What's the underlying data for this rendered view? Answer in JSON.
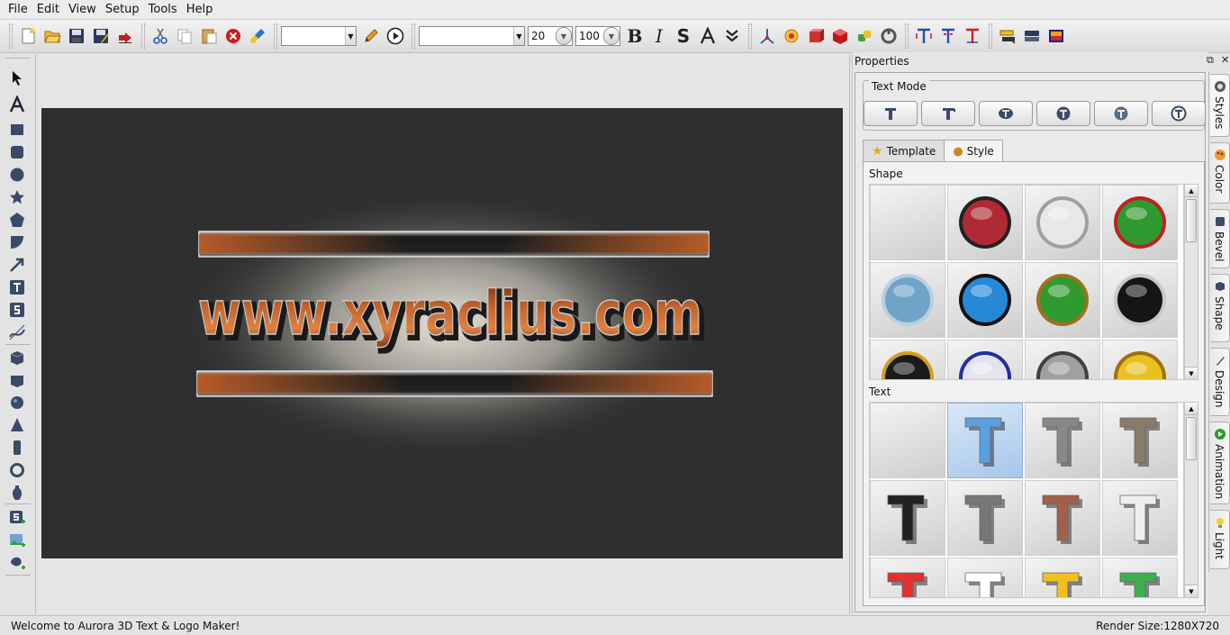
{
  "menu": [
    "File",
    "Edit",
    "View",
    "Setup",
    "Tools",
    "Help"
  ],
  "toolbar": {
    "font_size": "20",
    "zoom": "100",
    "bold_label": "B",
    "italic_label": "I",
    "strike_label": "S"
  },
  "canvas": {
    "logo_text": "www.xyraclius.com",
    "background_color": "#2f2f2f",
    "glow_color": "#d8d6c8",
    "text_color": "#b85a28"
  },
  "properties": {
    "title": "Properties",
    "text_mode_label": "Text Mode",
    "tabs": [
      {
        "label": "Template",
        "icon": "star-icon"
      },
      {
        "label": "Style",
        "icon": "palette-icon"
      }
    ],
    "shape_label": "Shape",
    "text_label": "Text"
  },
  "side_tabs": [
    {
      "label": "Styles",
      "icon": "styles-icon"
    },
    {
      "label": "Color",
      "icon": "color-icon"
    },
    {
      "label": "Bevel",
      "icon": "bevel-icon"
    },
    {
      "label": "Shape",
      "icon": "shape-icon"
    },
    {
      "label": "Design",
      "icon": "design-icon"
    },
    {
      "label": "Animation",
      "icon": "animation-icon"
    },
    {
      "label": "Light",
      "icon": "light-icon"
    }
  ],
  "status": {
    "message": "Welcome to Aurora 3D Text & Logo Maker!",
    "render_size": "Render Size:1280X720"
  },
  "shape_swatches": [
    "#e3e3e3",
    "#b02a35",
    "#e8e8e8",
    "#2f9a2f",
    "#6fa4c8",
    "#2589d8",
    "#2f9a2f",
    "#151515",
    "#1a1a1a",
    "#e4e4f0",
    "#a0a0a0",
    "#e8c020"
  ],
  "shape_rims": [
    "none",
    "#222222",
    "#a0a0a0",
    "#c02020",
    "#b8cfe0",
    "#111111",
    "#a07020",
    "#c8c8c8",
    "#d0a020",
    "#2030a0",
    "#404040",
    "#a07010"
  ],
  "text_swatches": [
    "none",
    "#5aa0e0",
    "#888888",
    "#8a7a6a",
    "#222222",
    "#777777",
    "#a0604a",
    "#eeeeee",
    "#e03030",
    "#ffffff",
    "#f0c020",
    "#3cb050"
  ]
}
